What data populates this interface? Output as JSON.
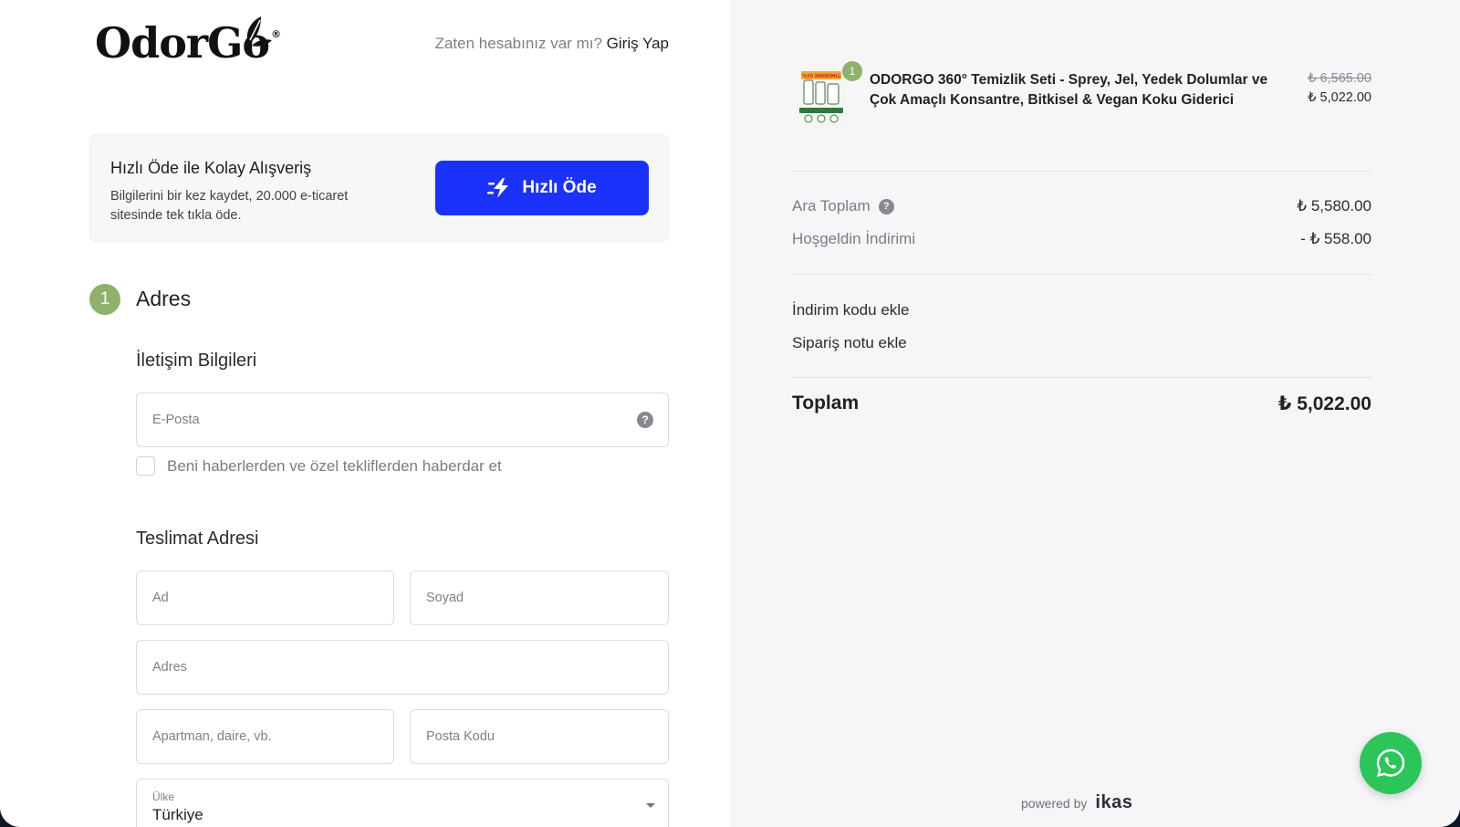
{
  "brand": {
    "logo_text": "OdorGo",
    "registered_mark": "®"
  },
  "header": {
    "login_prompt": "Zaten hesabınız var mı?",
    "login_link": "Giriş Yap"
  },
  "fastpay": {
    "title": "Hızlı Öde ile Kolay Alışveriş",
    "description": "Bilgilerini bir kez kaydet, 20.000 e-ticaret sitesinde tek tıkla öde.",
    "button_label": "Hızlı Öde",
    "accent": "#1b32fa"
  },
  "step": {
    "number": "1",
    "title": "Adres",
    "color": "#8fb16c"
  },
  "contact": {
    "title": "İletişim Bilgileri",
    "email_placeholder": "E-Posta",
    "help_icon": "?",
    "newsletter_label": "Beni haberlerden ve özel tekliflerden haberdar et"
  },
  "delivery": {
    "title": "Teslimat Adresi",
    "first_name_placeholder": "Ad",
    "last_name_placeholder": "Soyad",
    "address_placeholder": "Adres",
    "apartment_placeholder": "Apartman, daire, vb.",
    "postal_placeholder": "Posta Kodu",
    "country_label": "Ülke",
    "country_value": "Türkiye"
  },
  "cart": {
    "quantity": "1",
    "product_name": "ODORGO 360° Temizlik Seti - Sprey, Jel, Yedek Dolumlar ve Çok Amaçlı Konsantre, Bitkisel & Vegan Koku Giderici",
    "price_old": "₺ 6,565.00",
    "price_new": "₺ 5,022.00",
    "thumb_banner": "%50 İNDİRİMLİ"
  },
  "summary": {
    "subtotal_label": "Ara Toplam",
    "subtotal_value": "₺ 5,580.00",
    "discount_label": "Hoşgeldin İndirimi",
    "discount_value": "- ₺ 558.00",
    "add_discount": "İndirim kodu ekle",
    "add_note": "Sipariş notu ekle",
    "total_label": "Toplam",
    "total_value": "₺ 5,022.00"
  },
  "footer": {
    "powered_by": "powered by",
    "provider": "ikas"
  },
  "whatsapp": {
    "icon": "whatsapp-icon",
    "color": "#2bc55a"
  }
}
